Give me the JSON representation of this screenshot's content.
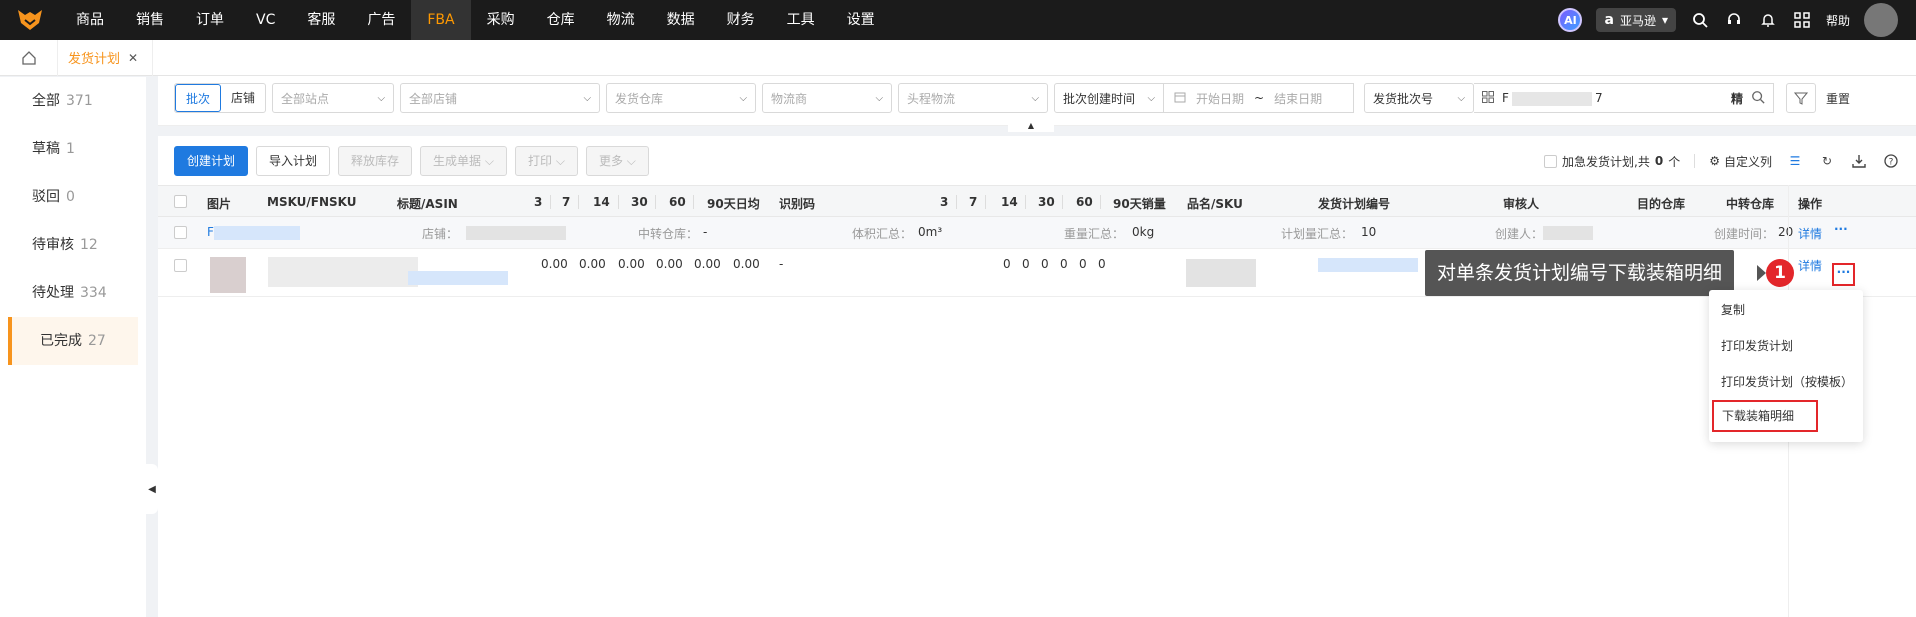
{
  "nav": {
    "items": [
      "商品",
      "销售",
      "订单",
      "VC",
      "客服",
      "广告",
      "FBA",
      "采购",
      "仓库",
      "物流",
      "数据",
      "财务",
      "工具",
      "设置"
    ],
    "active": "FBA",
    "ai_label": "AI",
    "marketplace": "亚马逊",
    "help": "帮助"
  },
  "tabs": {
    "current": "发货计划"
  },
  "sidebar": {
    "items": [
      {
        "label": "全部",
        "count": "371"
      },
      {
        "label": "草稿",
        "count": "1"
      },
      {
        "label": "驳回",
        "count": "0"
      },
      {
        "label": "待审核",
        "count": "12"
      },
      {
        "label": "待处理",
        "count": "334"
      },
      {
        "label": "已完成",
        "count": "27"
      }
    ],
    "active_index": 5
  },
  "filters": {
    "mode_batch": "批次",
    "mode_store": "店铺",
    "all_sites": "全部站点",
    "all_stores": "全部店铺",
    "ship_warehouse": "发货仓库",
    "carrier": "物流商",
    "first_leg": "头程物流",
    "batch_time": "批次创建时间",
    "start_date": "开始日期",
    "tilde": "~",
    "end_date": "结束日期",
    "batch_no_label": "发货批次号",
    "search_prefix": "F",
    "search_suffix": "7",
    "exact": "精",
    "reset": "重置"
  },
  "toolbar": {
    "create": "创建计划",
    "import": "导入计划",
    "release": "释放库存",
    "generate": "生成单据",
    "print": "打印",
    "more": "更多",
    "urgent_prefix": "加急发货计划,共",
    "urgent_count": "0",
    "urgent_unit": "个",
    "custom_cols": "自定义列"
  },
  "table": {
    "headers": {
      "image": "图片",
      "msku": "MSKU/FNSKU",
      "title": "标题/ASIN",
      "d3": "3",
      "d7": "7",
      "d14": "14",
      "d30": "30",
      "d60": "60",
      "avg90": "90天日均",
      "idcode": "识别码",
      "s3": "3",
      "s7": "7",
      "s14": "14",
      "s30": "30",
      "s60": "60",
      "sales90": "90天销量",
      "product": "品名/SKU",
      "plan_no": "发货计划编号",
      "reviewer": "审核人",
      "dest": "目的仓库",
      "transit": "中转仓库",
      "ops": "操作"
    },
    "summary": {
      "prefix": "F",
      "store_label": "店铺：",
      "transit_label": "中转仓库：",
      "transit_value": "-",
      "volume_label": "体积汇总：",
      "volume_value": "0m³",
      "weight_label": "重量汇总：",
      "weight_value": "0kg",
      "plan_qty_label": "计划量汇总：",
      "plan_qty_value": "10",
      "creator_label": "创建人：",
      "created_label": "创建时间：",
      "created_value": "20",
      "detail": "详情",
      "more": "···"
    },
    "item": {
      "avg": [
        "0.00",
        "0.00",
        "0.00",
        "0.00",
        "0.00",
        "0.00"
      ],
      "idcode": "-",
      "sales": [
        "0",
        "0",
        "0",
        "0",
        "0",
        "0"
      ],
      "detail": "详情",
      "more": "···"
    }
  },
  "tooltip": {
    "text": "对单条发货计划编号下载装箱明细",
    "step": "1"
  },
  "menu": {
    "items": [
      "复制",
      "打印发货计划",
      "打印发货计划（按模板）",
      "下载装箱明细"
    ]
  }
}
